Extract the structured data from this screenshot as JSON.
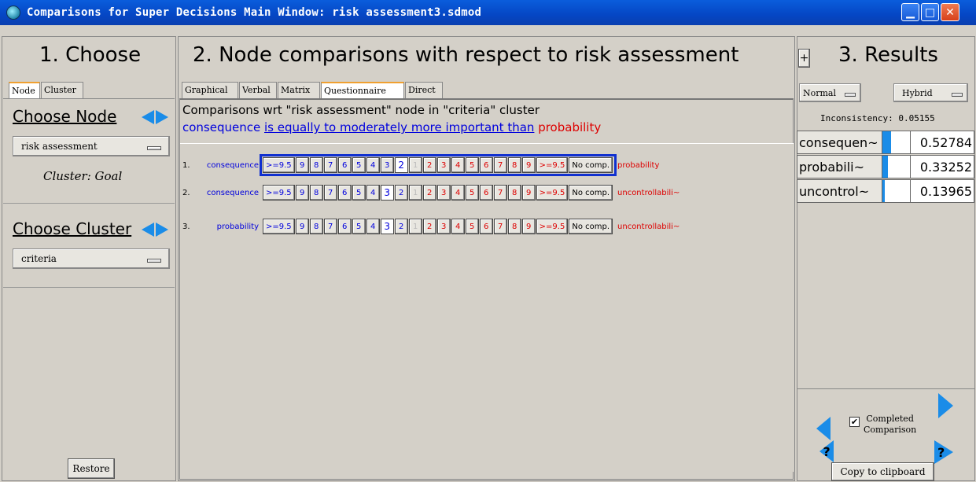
{
  "window": {
    "title": "Comparisons for Super Decisions Main Window: risk assessment3.sdmod",
    "min_glyph": "▁",
    "max_glyph": "□",
    "close_glyph": "✕"
  },
  "left": {
    "heading": "1. Choose",
    "tabs": [
      "Node",
      "Cluster"
    ],
    "choose_node_label": "Choose Node",
    "node_value": "risk assessment",
    "cluster_caption": "Cluster: Goal",
    "choose_cluster_label": "Choose Cluster",
    "cluster_value": "criteria",
    "restore_label": "Restore"
  },
  "middle": {
    "heading": "2. Node comparisons with respect to risk assessment",
    "tabs": [
      "Graphical",
      "Verbal",
      "Matrix",
      "Questionnaire",
      "Direct"
    ],
    "info_line": "Comparisons wrt \"risk assessment\" node in \"criteria\" cluster",
    "verbal": {
      "left": "consequence",
      "middle": "is equally to moderately more important than",
      "right": "probability"
    },
    "scale_left": [
      ">=9.5",
      "9",
      "8",
      "7",
      "6",
      "5",
      "4",
      "3",
      "2"
    ],
    "scale_one": "1",
    "scale_right": [
      "2",
      "3",
      "4",
      "5",
      "6",
      "7",
      "8",
      "9",
      ">=9.5"
    ],
    "no_comp_label": "No comp.",
    "rows": [
      {
        "number": "1.",
        "left": "consequence",
        "right": "probability",
        "selected": "left-2"
      },
      {
        "number": "2.",
        "left": "consequence",
        "right": "uncontrollabili~",
        "selected": "left-3"
      },
      {
        "number": "3.",
        "left": "probability",
        "right": "uncontrollabili~",
        "selected": "left-3"
      }
    ]
  },
  "right": {
    "plus": "+",
    "heading": "3. Results",
    "mode_normal": "Normal",
    "mode_hybrid": "Hybrid",
    "inconsistency_label": "Inconsistency: 0.05155",
    "results": [
      {
        "name": "consequen~",
        "value": "0.52784",
        "fraction": 0.52784
      },
      {
        "name": "probabili~",
        "value": "0.33252",
        "fraction": 0.33252
      },
      {
        "name": "uncontrol~",
        "value": "0.13965",
        "fraction": 0.13965
      }
    ],
    "completed_label_1": "Completed",
    "completed_label_2": "Comparison",
    "completed_checked": true,
    "check_glyph": "✔",
    "question_glyph": "?",
    "copy_label": "Copy to clipboard"
  },
  "colors": {
    "accent_blue": "#1a8ce8",
    "left_node_blue": "#0000dd",
    "right_node_red": "#dd0000"
  }
}
